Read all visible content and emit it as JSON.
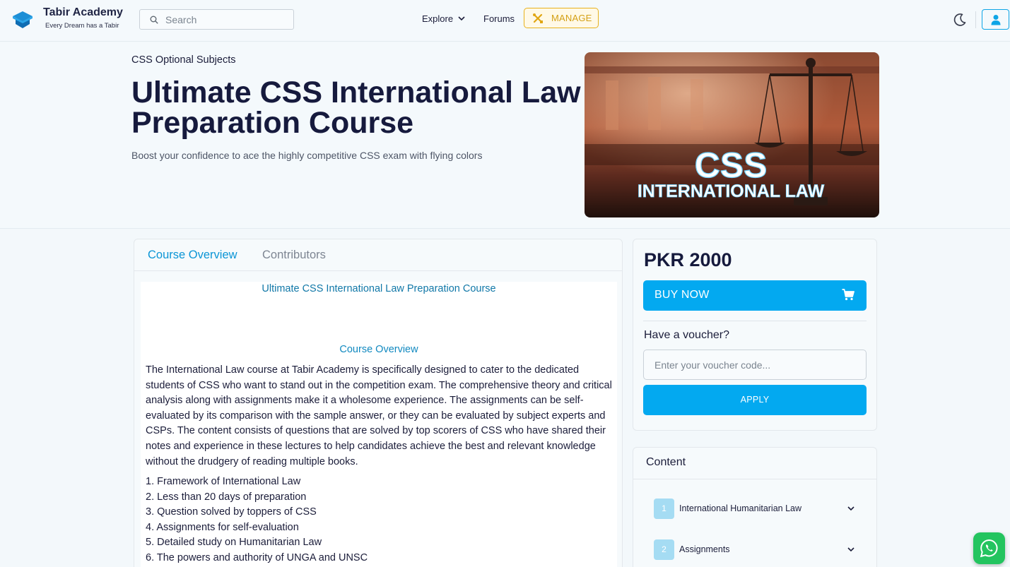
{
  "header": {
    "brand_name": "Tabir Academy",
    "brand_tagline": "Every Dream has a Tabir",
    "search_placeholder": "Search",
    "nav": {
      "explore": "Explore",
      "forums": "Forums",
      "manage": "MANAGE"
    },
    "icons": [
      "graduation-cap-icon",
      "search-icon",
      "chevron-down-icon",
      "tools-icon",
      "moon-icon",
      "user-icon"
    ],
    "accent_color": "#03a9f0",
    "manage_color": "#e8b11b"
  },
  "hero": {
    "category": "CSS Optional Subjects",
    "title": "Ultimate CSS International Law Preparation Course",
    "subtitle": "Boost your confidence to ace the highly competitive CSS exam with flying colors",
    "image_text": {
      "line1": "CSS",
      "line2": "INTERNATIONAL LAW"
    }
  },
  "tabs": [
    {
      "label": "Course Overview",
      "active": true
    },
    {
      "label": "Contributors",
      "active": false
    }
  ],
  "overview": {
    "title": "Ultimate CSS International Law Preparation Course",
    "section_heading": "Course Overview",
    "paragraph": "The International Law course at Tabir Academy is specifically designed to cater to the dedicated students of CSS who want to stand out in the competition exam. The comprehensive theory and critical analysis along with assignments make it a wholesome experience. The assignments can be self-evaluated by its comparison with the sample answer, or they can be evaluated by subject experts and CSPs. The content consists of questions that are solved by top scorers of CSS who have shared their notes and experience in these lectures to help candidates achieve the best and relevant knowledge without the drudgery of reading multiple books.",
    "points": [
      "1. Framework of International Law",
      "2. Less than 20 days of preparation",
      "3. Question solved by toppers of CSS",
      "4. Assignments for self-evaluation",
      "5. Detailed study on Humanitarian Law",
      "6. The powers and authority of UNGA and UNSC"
    ]
  },
  "purchase": {
    "price": "PKR 2000",
    "buy_label": "BUY NOW",
    "voucher_question": "Have a voucher?",
    "voucher_placeholder": "Enter your voucher code...",
    "apply_label": "APPLY"
  },
  "content": {
    "heading": "Content",
    "modules": [
      {
        "number": "1",
        "title": "International Humanitarian Law"
      },
      {
        "number": "2",
        "title": "Assignments"
      }
    ]
  }
}
